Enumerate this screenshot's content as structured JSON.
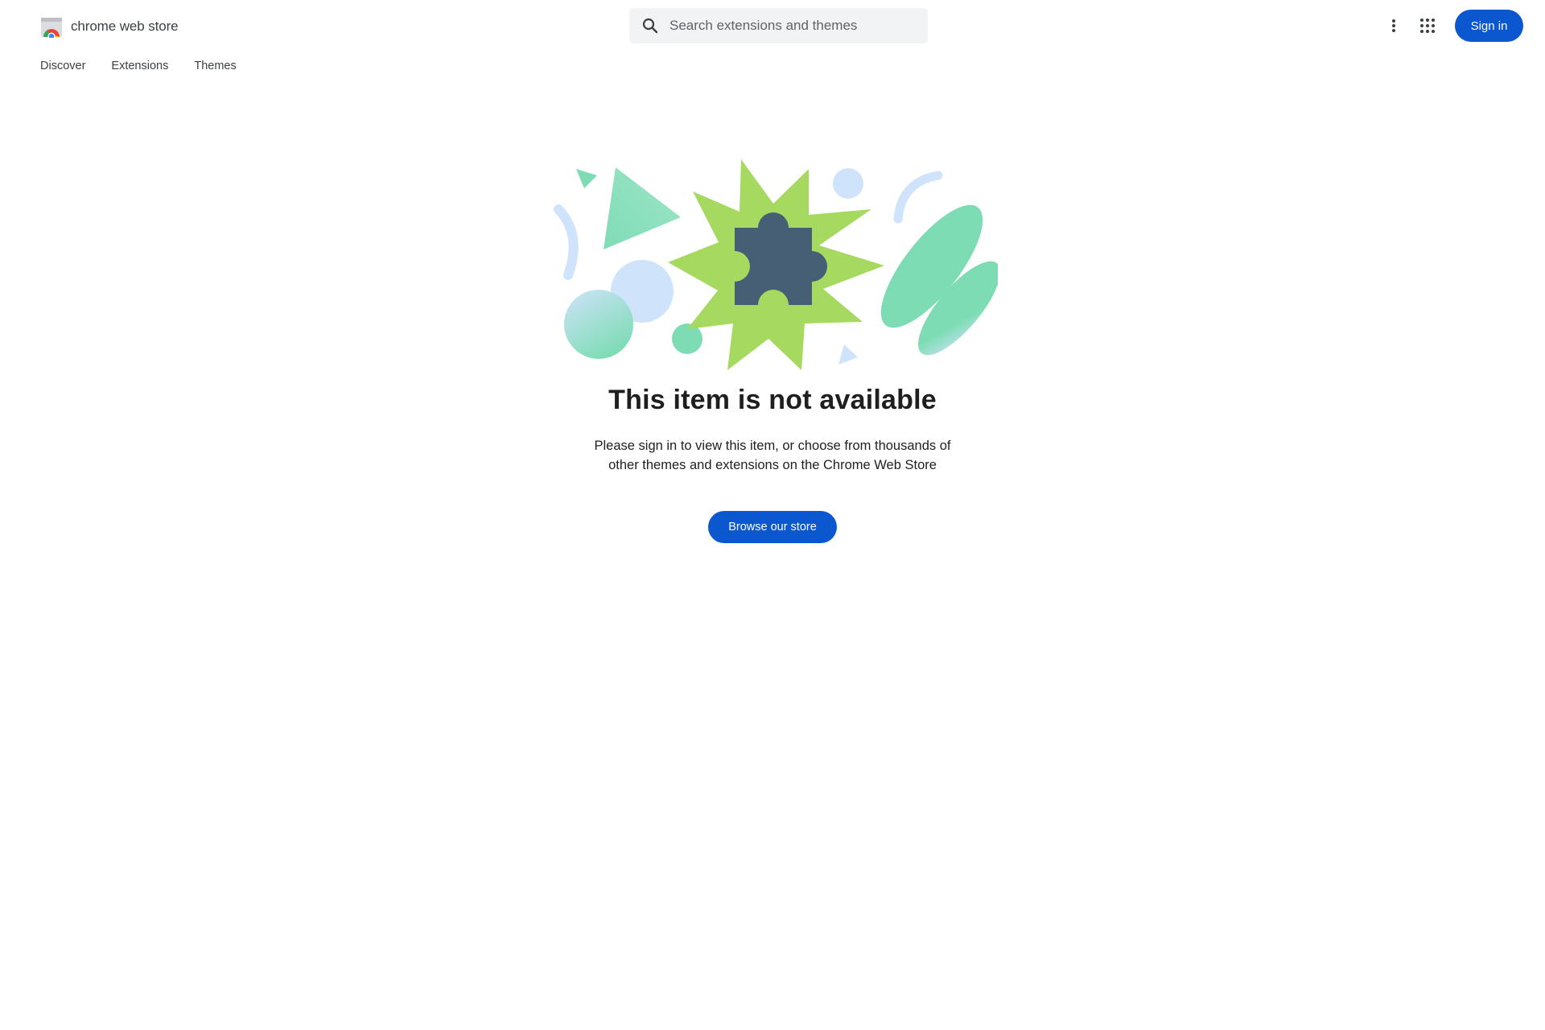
{
  "header": {
    "brand_name": "chrome web store",
    "search_placeholder": "Search extensions and themes",
    "search_value": "",
    "more_icon": "more-vert-icon",
    "apps_icon": "apps-grid-icon",
    "signin_label": "Sign in"
  },
  "nav": {
    "items": [
      {
        "label": "Discover"
      },
      {
        "label": "Extensions"
      },
      {
        "label": "Themes"
      }
    ]
  },
  "main": {
    "illustration_icon": "puzzle-piece-icon",
    "title": "This item is not available",
    "description": "Please sign in to view this item, or choose from thousands of other themes and extensions on the Chrome Web Store",
    "cta_label": "Browse our store"
  },
  "colors": {
    "primary_button": "#0b57d0",
    "search_background": "#f1f3f4",
    "starburst_green": "#a5d95f",
    "mint": "#7edcb5",
    "light_blue": "#cfe3fb",
    "puzzle_slate": "#475f74"
  }
}
